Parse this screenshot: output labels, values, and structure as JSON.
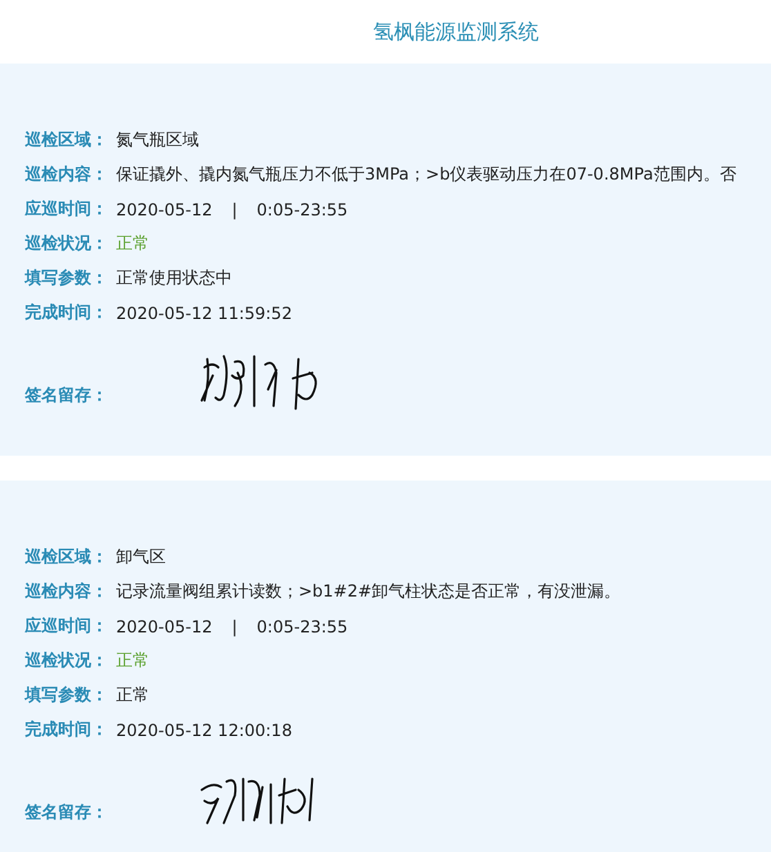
{
  "header": {
    "title": "氢枫能源监测系统"
  },
  "records": [
    {
      "fields": [
        {
          "kind": "text",
          "label": "巡检区域：",
          "value": "氮气瓶区域"
        },
        {
          "kind": "text",
          "label": "巡检内容：",
          "value": "保证撬外、撬内氮气瓶压力不低于3MPa；>b仪表驱动压力在07-0.8MPa范围内。否"
        },
        {
          "kind": "time",
          "label": "应巡时间：",
          "date": "2020-05-12",
          "separator": "|",
          "range": "0:05-23:55"
        },
        {
          "kind": "status",
          "label": "巡检状况：",
          "value": "正常"
        },
        {
          "kind": "text",
          "label": "填写参数：",
          "value": "正常使用状态中"
        },
        {
          "kind": "text",
          "label": "完成时间：",
          "value": "2020-05-12 11:59:52"
        },
        {
          "kind": "signature",
          "label": "签名留存："
        }
      ]
    },
    {
      "fields": [
        {
          "kind": "text",
          "label": "巡检区域：",
          "value": "卸气区"
        },
        {
          "kind": "text",
          "label": "巡检内容：",
          "value": "记录流量阀组累计读数；>b1#2#卸气柱状态是否正常，有没泄漏。"
        },
        {
          "kind": "time",
          "label": "应巡时间：",
          "date": "2020-05-12",
          "separator": "|",
          "range": "0:05-23:55"
        },
        {
          "kind": "status",
          "label": "巡检状况：",
          "value": "正常"
        },
        {
          "kind": "text",
          "label": "填写参数：",
          "value": "正常"
        },
        {
          "kind": "text",
          "label": "完成时间：",
          "value": "2020-05-12 12:00:18"
        },
        {
          "kind": "signature",
          "label": "签名留存："
        }
      ]
    }
  ]
}
